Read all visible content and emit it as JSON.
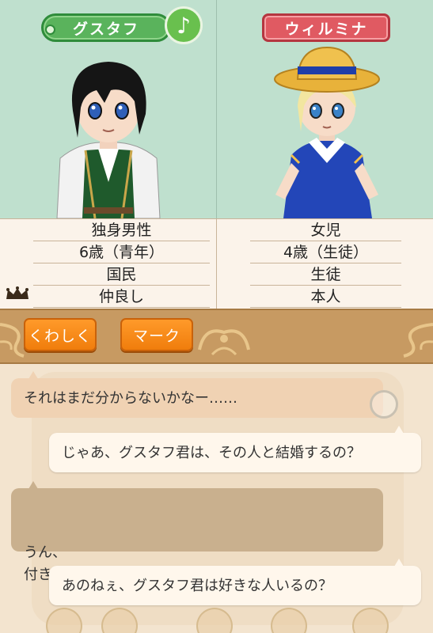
{
  "left_character": {
    "name": "グスタフ",
    "info": [
      "独身男性",
      "6歳（青年）",
      "国民",
      "仲良し"
    ]
  },
  "right_character": {
    "name": "ウィルミナ",
    "info": [
      "女児",
      "4歳（生徒）",
      "生徒",
      "本人"
    ]
  },
  "music_button": {
    "icon": "music-note-icon",
    "glyph": "♪"
  },
  "actions": {
    "detail_label": "くわしく",
    "mark_label": "マーク"
  },
  "chat": [
    {
      "side": "left",
      "text": "それはまだ分からないかなー……"
    },
    {
      "side": "right",
      "text": "じゃあ、グスタフ君は、その人と結婚するの？"
    },
    {
      "side": "left",
      "text": "うん、\n付き合ってる人がいるんだ"
    },
    {
      "side": "right",
      "text": "あのねぇ、グスタフ君は好きな人いるの？"
    }
  ],
  "colors": {
    "portrait_bg": "#bfe0ce",
    "left_tag": "#5ab35c",
    "right_tag": "#e05a62",
    "action_bar": "#c79a62",
    "button": "#f07d0c"
  }
}
